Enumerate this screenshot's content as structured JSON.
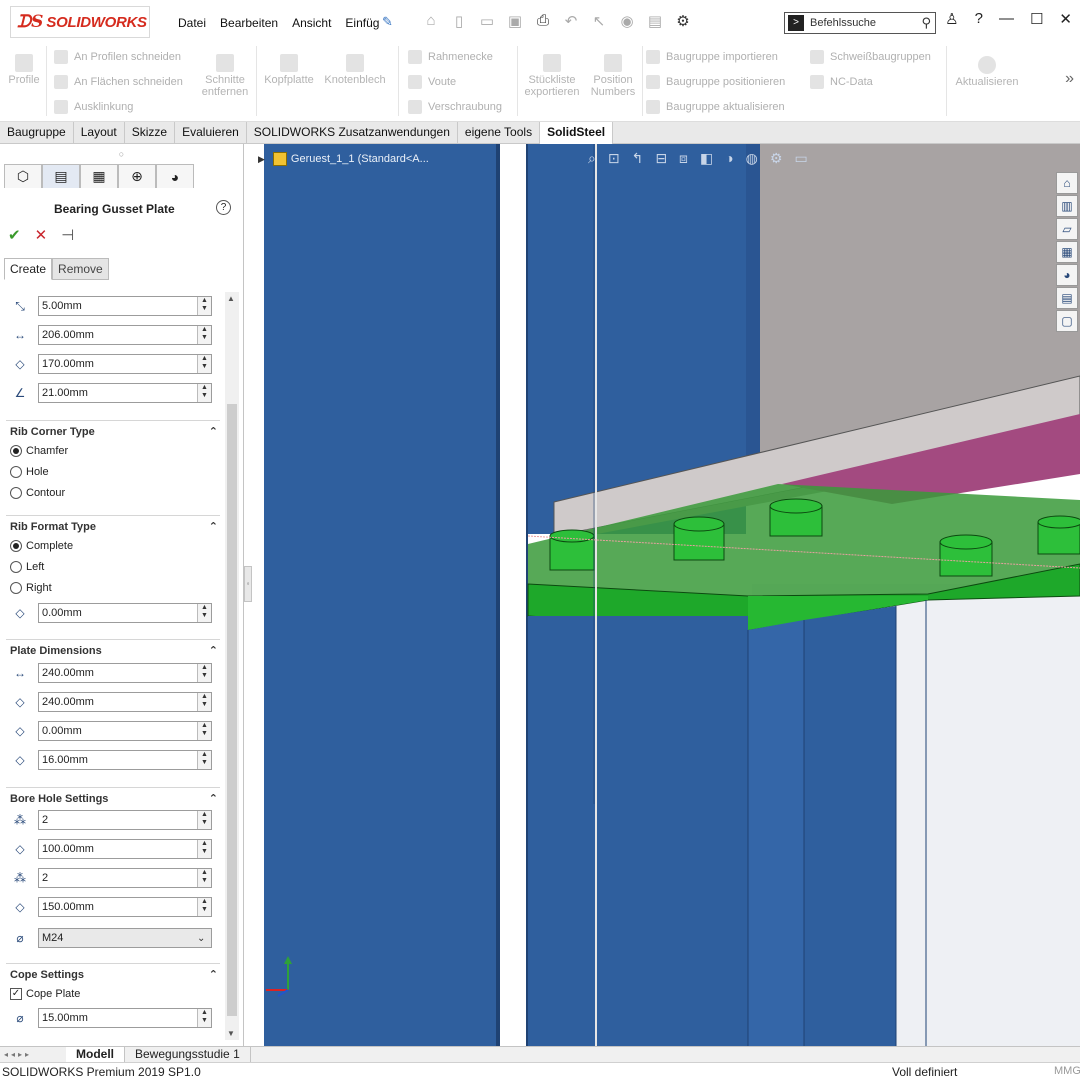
{
  "app": {
    "logo_text": "SOLIDWORKS",
    "menu": [
      "Datei",
      "Bearbeiten",
      "Ansicht",
      "Einfüg"
    ],
    "search_placeholder": "Befehlssuche",
    "help_label": "?"
  },
  "ribbon": {
    "profile": "Profile",
    "an_profilen": "An Profilen schneiden",
    "an_flaechen": "An Flächen schneiden",
    "ausklinkung": "Ausklinkung",
    "schnitte_1": "Schnitte",
    "schnitte_2": "entfernen",
    "kopfplatte": "Kopfplatte",
    "knotenblech": "Knotenblech",
    "rahmenecke": "Rahmenecke",
    "voute": "Voute",
    "verschraubung": "Verschraubung",
    "stueckliste_1": "Stückliste",
    "stueckliste_2": "exportieren",
    "position_1": "Position",
    "position_2": "Numbers",
    "bg_importieren": "Baugruppe importieren",
    "bg_positionieren": "Baugruppe positionieren",
    "bg_aktualisieren": "Baugruppe aktualisieren",
    "schweiss": "Schweißbaugruppen",
    "ncdata": "NC-Data",
    "aktualisieren": "Aktualisieren"
  },
  "tabs": [
    "Baugruppe",
    "Layout",
    "Skizze",
    "Evaluieren",
    "SOLIDWORKS Zusatzanwendungen",
    "eigene Tools",
    "SolidSteel"
  ],
  "active_tab": "SolidSteel",
  "panel": {
    "title": "Bearing Gusset Plate",
    "subtabs": [
      "Create",
      "Remove"
    ],
    "params": [
      "5.00mm",
      "206.00mm",
      "170.00mm",
      "21.00mm"
    ],
    "rib_corner": {
      "title": "Rib Corner Type",
      "options": [
        "Chamfer",
        "Hole",
        "Contour"
      ],
      "selected": "Chamfer"
    },
    "rib_format": {
      "title": "Rib Format Type",
      "options": [
        "Complete",
        "Left",
        "Right"
      ],
      "selected": "Complete",
      "value": "0.00mm"
    },
    "plate_dims": {
      "title": "Plate Dimensions",
      "values": [
        "240.00mm",
        "240.00mm",
        "0.00mm",
        "16.00mm"
      ]
    },
    "bore_hole": {
      "title": "Bore Hole Settings",
      "values": [
        "2",
        "100.00mm",
        "2",
        "150.00mm"
      ],
      "bolt": "M24"
    },
    "cope": {
      "title": "Cope Settings",
      "checkbox_label": "Cope Plate",
      "checked": true,
      "value": "15.00mm"
    }
  },
  "viewport": {
    "tree_label": "Geruest_1_1  (Standard<A...",
    "colors": {
      "beam": "#2f5f9e",
      "beam_dark": "#1f4273",
      "plate_green": "#1ea82a",
      "upper_gray": "#a8a3a3",
      "magenta": "#a34a80",
      "background": "#ffffff"
    }
  },
  "bottom_tabs": [
    "Modell",
    "Bewegungsstudie 1"
  ],
  "active_bottom_tab": "Modell",
  "status": {
    "left": "SOLIDWORKS Premium 2019 SP1.0",
    "right": "Voll definiert",
    "units": "MMG"
  }
}
